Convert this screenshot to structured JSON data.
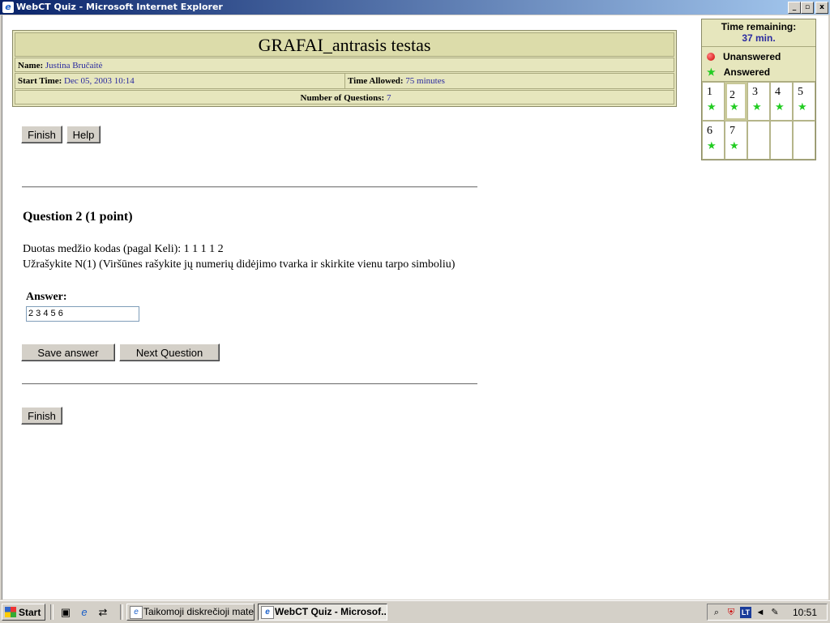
{
  "window": {
    "title": "WebCT Quiz - Microsoft Internet Explorer",
    "minimize": "_",
    "restore": "▫",
    "close": "x"
  },
  "header": {
    "quiz_title": "GRAFAI_antrasis testas",
    "name_label": "Name:",
    "name_value": "Justina Bručaitė",
    "start_label": "Start Time:",
    "start_value": "Dec 05, 2003 10:14",
    "allowed_label": "Time Allowed:",
    "allowed_value": "75 minutes",
    "numq_label": "Number of Questions:",
    "numq_value": "7"
  },
  "top_buttons": {
    "finish": "Finish",
    "help": "Help"
  },
  "question": {
    "title": "Question 2   (1 point)",
    "line1": "Duotas medžio kodas (pagal Keli): 1 1 1 1 2",
    "line2": "Užrašykite N(1) (Viršūnes rašykite jų numerių didėjimo tvarka ir skirkite vienu tarpo simboliu)",
    "answer_label": "Answer:",
    "answer_value": "2 3 4 5 6"
  },
  "answer_buttons": {
    "save": "Save answer",
    "next": "Next Question"
  },
  "bottom_buttons": {
    "finish": "Finish"
  },
  "panel": {
    "time_label": "Time remaining:",
    "time_value": "37 min.",
    "legend_unanswered": "Unanswered",
    "legend_answered": "Answered",
    "questions": [
      {
        "num": "1",
        "status": "answered"
      },
      {
        "num": "2",
        "status": "answered",
        "current": true
      },
      {
        "num": "3",
        "status": "answered"
      },
      {
        "num": "4",
        "status": "answered"
      },
      {
        "num": "5",
        "status": "answered"
      },
      {
        "num": "6",
        "status": "answered"
      },
      {
        "num": "7",
        "status": "answered"
      }
    ]
  },
  "taskbar": {
    "start": "Start",
    "tasks": [
      "Taikomoji diskrečioji mate...",
      "WebCT Quiz - Microsof..."
    ],
    "tray_lang": "LT",
    "clock": "10:51"
  },
  "colors": {
    "header_bg": "#e6e6bd",
    "value_text": "#2a2aa0",
    "answered_star": "#22cc22",
    "unanswered_dot": "#d00000"
  },
  "icons": [
    "ie-icon",
    "windows-flag-icon",
    "show-desktop-icon",
    "ie-quicklaunch-icon",
    "network-icon",
    "search-tray-icon",
    "shield-tray-icon",
    "volume-icon",
    "tools-icon"
  ]
}
